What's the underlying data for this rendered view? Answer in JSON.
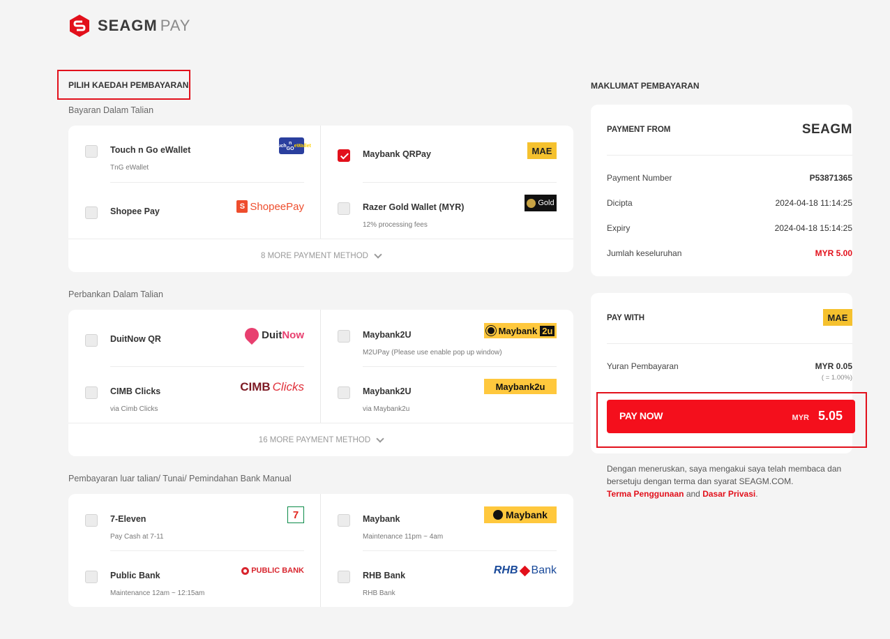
{
  "brand": {
    "logo_main": "SEAGM",
    "logo_pay": "PAY"
  },
  "left": {
    "title": "PILIH KAEDAH PEMBAYARAN",
    "sections": [
      {
        "label": "Bayaran Dalam Talian",
        "more": "8 MORE PAYMENT METHOD",
        "methods": [
          {
            "name": "Touch n Go eWallet",
            "sub": "TnG eWallet",
            "checked": false,
            "icon": "touch-n-go-logo"
          },
          {
            "name": "Maybank QRPay",
            "sub": "",
            "checked": true,
            "icon": "mae-logo"
          },
          {
            "name": "Shopee Pay",
            "sub": "",
            "checked": false,
            "icon": "shopeepay-logo"
          },
          {
            "name": "Razer Gold Wallet (MYR)",
            "sub": "12% processing fees",
            "checked": false,
            "icon": "razer-gold-logo"
          }
        ]
      },
      {
        "label": "Perbankan Dalam Talian",
        "more": "16 MORE PAYMENT METHOD",
        "methods": [
          {
            "name": "DuitNow QR",
            "sub": "",
            "checked": false,
            "icon": "duitnow-logo"
          },
          {
            "name": "Maybank2U",
            "sub": "M2UPay (Please use enable pop up window)",
            "checked": false,
            "icon": "maybank2u-logo"
          },
          {
            "name": "CIMB Clicks",
            "sub": "via Cimb Clicks",
            "checked": false,
            "icon": "cimb-clicks-logo"
          },
          {
            "name": "Maybank2U",
            "sub": "via Maybank2u",
            "checked": false,
            "icon": "maybank2u-logo"
          }
        ]
      },
      {
        "label": "Pembayaran luar talian/ Tunai/ Pemindahan Bank Manual",
        "more": "",
        "methods": [
          {
            "name": "7-Eleven",
            "sub": "Pay Cash at 7-11",
            "checked": false,
            "icon": "seven-eleven-logo"
          },
          {
            "name": "Maybank",
            "sub": "Maintenance 11pm ~ 4am",
            "checked": false,
            "icon": "maybank-logo"
          },
          {
            "name": "Public Bank",
            "sub": "Maintenance 12am ~ 12:15am",
            "checked": false,
            "icon": "public-bank-logo"
          },
          {
            "name": "RHB Bank",
            "sub": "RHB Bank",
            "checked": false,
            "icon": "rhb-bank-logo"
          }
        ]
      }
    ],
    "logos": {
      "tng_top": "Touch",
      "tng_mid": "n GO",
      "tng_bottom": "eWallet",
      "mae": "MAE",
      "shopee_bag": "S",
      "shopee": "ShopeePay",
      "razer": "Gold",
      "duit": "Duit",
      "now": "Now",
      "m2u_may": "Maybank",
      "m2u_2u": "2u",
      "m2u_full": "Maybank2u",
      "cimb": "CIMB",
      "clicks": "Clicks",
      "seven": "7",
      "maybank": "Maybank",
      "pbb": "PUBLIC BANK",
      "rhb": "RHB",
      "rhb_bank": "Bank"
    }
  },
  "right": {
    "title": "MAKLUMAT PEMBAYARAN",
    "payment_from": "PAYMENT FROM",
    "from_logo": "SEAGM",
    "rows": [
      {
        "label": "Payment Number",
        "value": "P53871365"
      },
      {
        "label": "Dicipta",
        "value": "2024-04-18 11:14:25"
      },
      {
        "label": "Expiry",
        "value": "2024-04-18 15:14:25"
      },
      {
        "label": "Jumlah keseluruhan",
        "value": "MYR 5.00"
      }
    ],
    "pay_with": "PAY WITH",
    "pay_with_logo": "MAE",
    "fee_label": "Yuran Pembayaran",
    "fee_value": "MYR 0.05",
    "fee_rate": "( = 1.00%)",
    "pay_button": {
      "label": "PAY NOW",
      "currency": "MYR",
      "amount": "5.05"
    },
    "terms_text": "Dengan meneruskan, saya mengakui saya telah membaca dan bersetuju dengan terma dan syarat SEAGM.COM.",
    "terms_link": "Terma Penggunaan",
    "terms_and": "and",
    "privacy_link": "Dasar Privasi",
    "terms_end": "."
  },
  "colors": {
    "accent": "#e2101b",
    "button": "#f40f1c",
    "total": "#e2101b"
  }
}
